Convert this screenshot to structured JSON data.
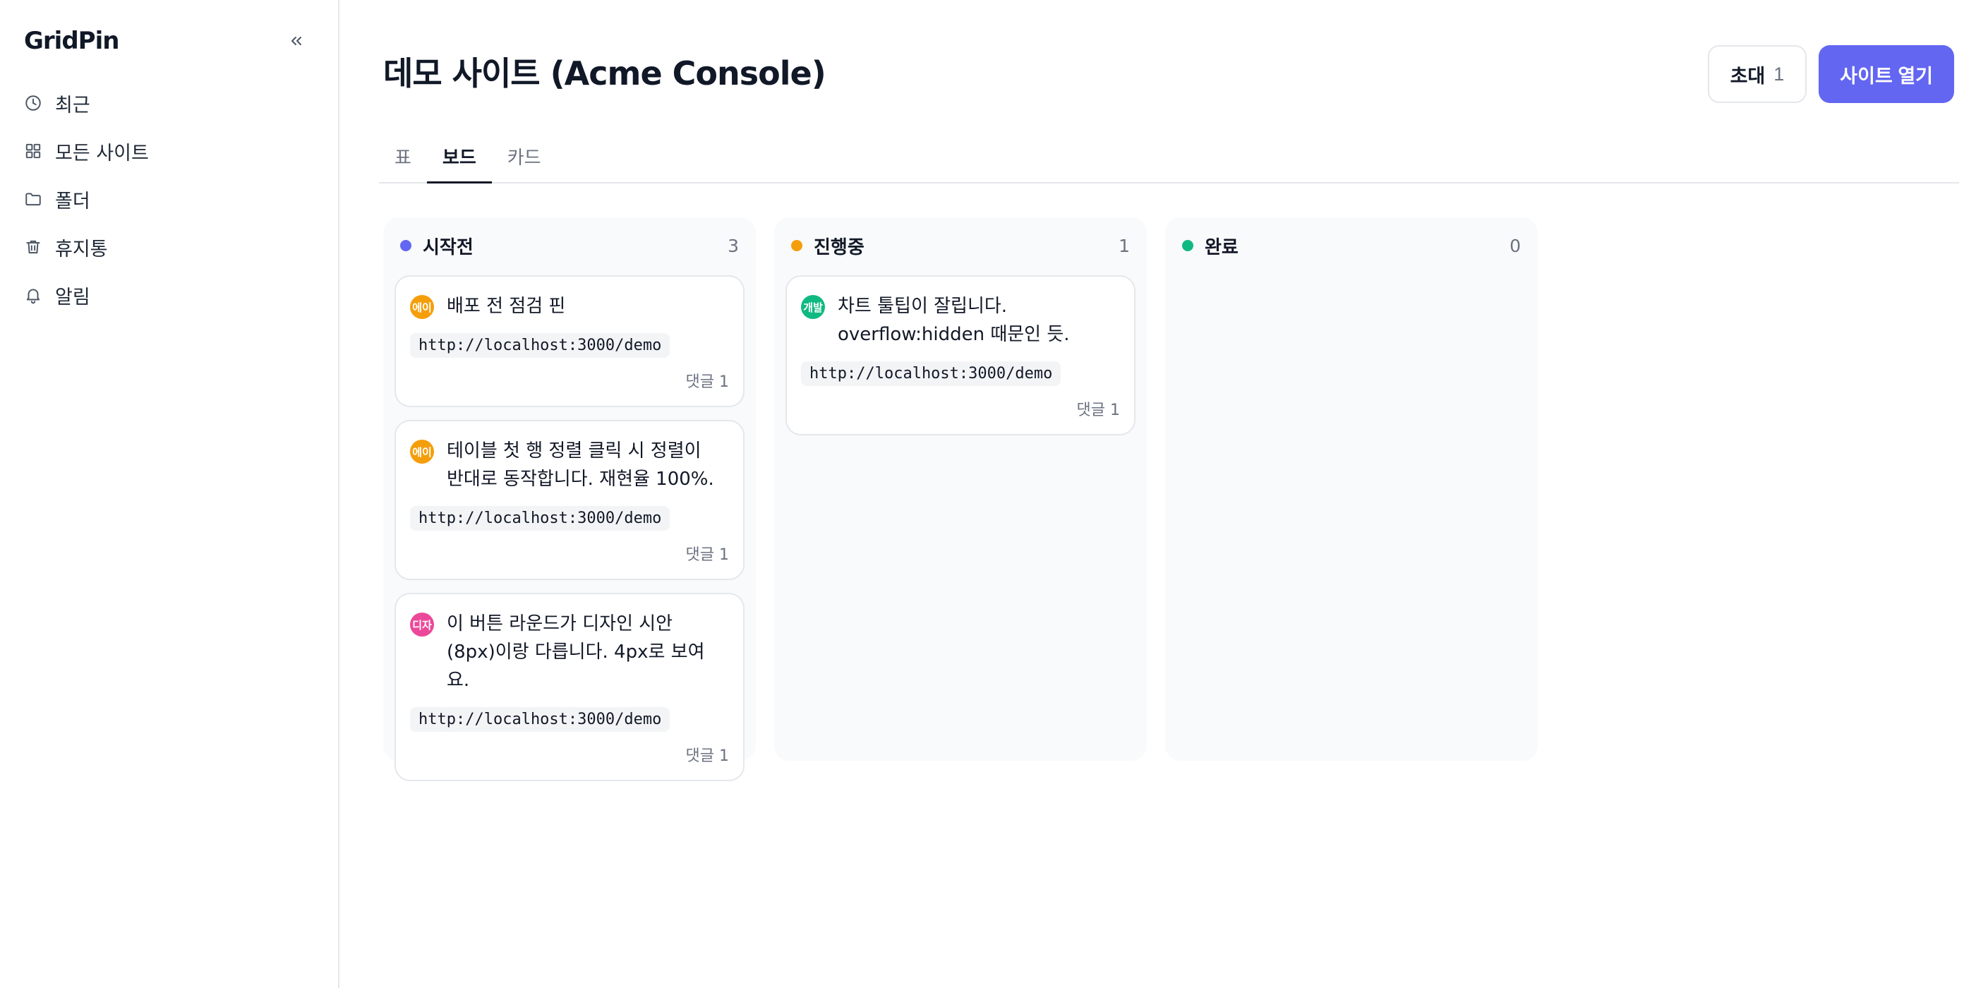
{
  "sidebar": {
    "brand": "GridPin",
    "items": [
      {
        "label": "최근",
        "icon": "clock-icon"
      },
      {
        "label": "모든 사이트",
        "icon": "grid-icon"
      },
      {
        "label": "폴더",
        "icon": "folder-icon"
      },
      {
        "label": "휴지통",
        "icon": "trash-icon"
      },
      {
        "label": "알림",
        "icon": "bell-icon"
      }
    ]
  },
  "header": {
    "title": "데모 사이트 (Acme Console)",
    "invite_label": "초대",
    "invite_count": "1",
    "open_label": "사이트 열기"
  },
  "tabs": [
    {
      "label": "표",
      "active": false
    },
    {
      "label": "보드",
      "active": true
    },
    {
      "label": "카드",
      "active": false
    }
  ],
  "colors": {
    "accent": "#6366f1",
    "todo": "#6366f1",
    "in_progress": "#f59e0b",
    "done": "#10b981",
    "avatar_orange": "#f59e0b",
    "avatar_green": "#10b981",
    "avatar_pink": "#ec4899"
  },
  "columns": [
    {
      "title": "시작전",
      "count": "3",
      "cards": [
        {
          "avatar": "에이",
          "text": "배포 전 점검 핀",
          "url": "http://localhost:3000/demo",
          "comments": "댓글 1"
        },
        {
          "avatar": "에이",
          "text": "테이블 첫 행 정렬 클릭 시 정렬이 반대로 동작합니다. 재현율 100%.",
          "url": "http://localhost:3000/demo",
          "comments": "댓글 1"
        },
        {
          "avatar": "디자",
          "text": "이 버튼 라운드가 디자인 시안(8px)이랑 다릅니다. 4px로 보여요.",
          "url": "http://localhost:3000/demo",
          "comments": "댓글 1"
        }
      ]
    },
    {
      "title": "진행중",
      "count": "1",
      "cards": [
        {
          "avatar": "개발",
          "text": "차트 툴팁이 잘립니다. overflow:hidden 때문인 듯.",
          "url": "http://localhost:3000/demo",
          "comments": "댓글 1"
        }
      ]
    },
    {
      "title": "완료",
      "count": "0",
      "cards": []
    }
  ]
}
